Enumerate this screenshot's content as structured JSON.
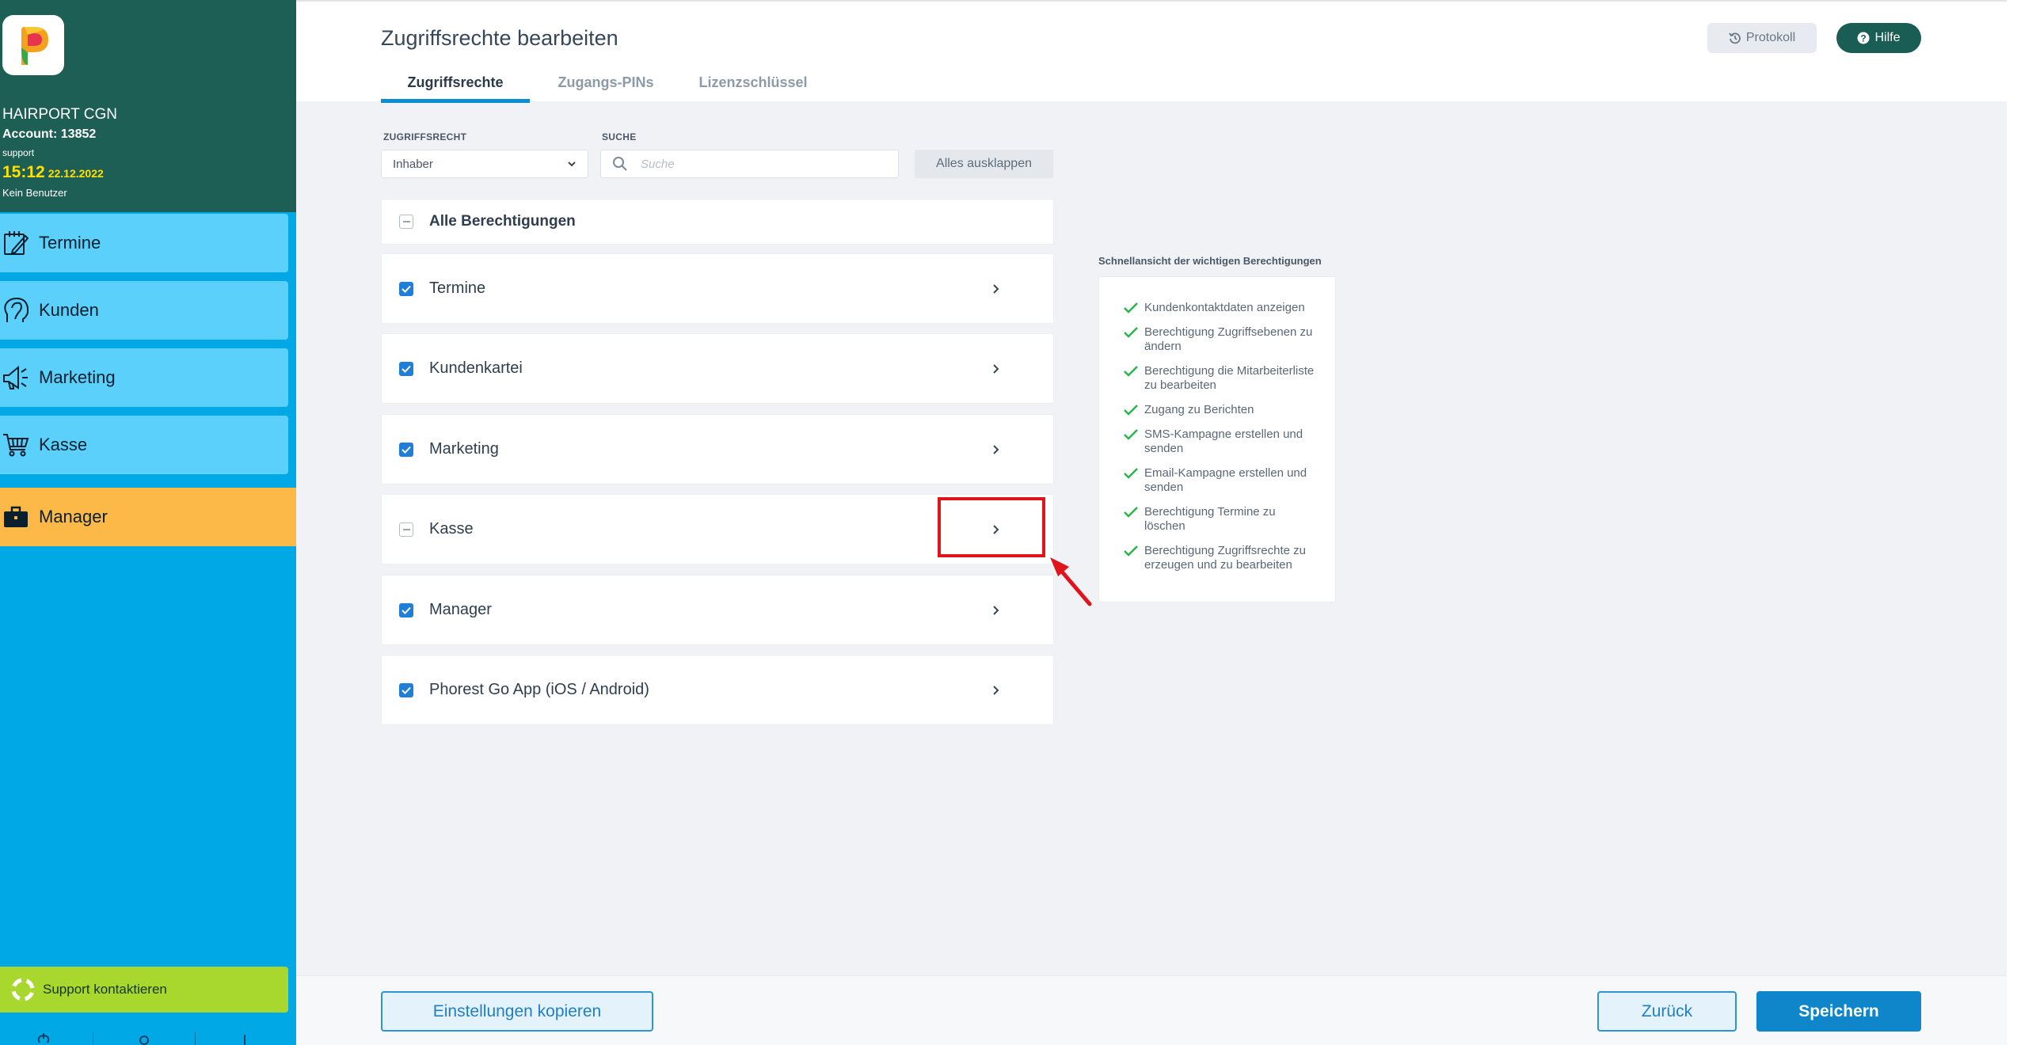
{
  "sidebar": {
    "salon_name": "HAIRPORT CGN",
    "account": "Account: 13852",
    "user": "support",
    "time": "15:12",
    "date": "22.12.2022",
    "no_user": "Kein Benutzer",
    "items": [
      {
        "label": "Termine",
        "icon": "calendar-edit-icon"
      },
      {
        "label": "Kunden",
        "icon": "customer-head-icon"
      },
      {
        "label": "Marketing",
        "icon": "megaphone-icon"
      },
      {
        "label": "Kasse",
        "icon": "shopping-cart-icon"
      },
      {
        "label": "Manager",
        "icon": "briefcase-icon",
        "active": true
      }
    ],
    "support_label": "Support kontaktieren"
  },
  "header": {
    "title": "Zugriffsrechte bearbeiten",
    "tabs": [
      {
        "label": "Zugriffsrechte",
        "active": true
      },
      {
        "label": "Zugangs-PINs"
      },
      {
        "label": "Lizenzschlüssel"
      }
    ],
    "protokoll_label": "Protokoll",
    "hilfe_label": "Hilfe"
  },
  "filters": {
    "access_label": "ZUGRIFFSRECHT",
    "access_value": "Inhaber",
    "search_label": "SUCHE",
    "search_placeholder": "Suche",
    "expand_label": "Alles ausklappen"
  },
  "permissions": {
    "all_label": "Alle Berechtigungen",
    "items": [
      {
        "label": "Termine",
        "state": "checked"
      },
      {
        "label": "Kundenkartei",
        "state": "checked"
      },
      {
        "label": "Marketing",
        "state": "checked"
      },
      {
        "label": "Kasse",
        "state": "partial"
      },
      {
        "label": "Manager",
        "state": "checked"
      },
      {
        "label": "Phorest Go App (iOS / Android)",
        "state": "checked"
      }
    ]
  },
  "quick_view": {
    "title": "Schnellansicht der wichtigen Berechtigungen",
    "items": [
      "Kundenkontaktdaten anzeigen",
      "Berechtigung Zugriffsebenen zu ändern",
      "Berechtigung die Mitarbeiterliste zu bearbeiten",
      "Zugang zu Berichten",
      "SMS-Kampagne erstellen und senden",
      "Email-Kampagne erstellen und senden",
      "Berechtigung Termine zu löschen",
      "Berechtigung Zugriffsrechte zu erzeugen und zu bearbeiten"
    ]
  },
  "footer": {
    "copy_label": "Einstellungen kopieren",
    "back_label": "Zurück",
    "save_label": "Speichern"
  },
  "colors": {
    "sidebar": "#00a9e6",
    "sidebar_header": "#1d5e55",
    "nav_item": "#5ad0fb",
    "nav_active": "#fdb947",
    "support": "#a8d82e",
    "primary": "#0f86c9",
    "check_green": "#2cb34a",
    "highlight_red": "#e0151c"
  }
}
